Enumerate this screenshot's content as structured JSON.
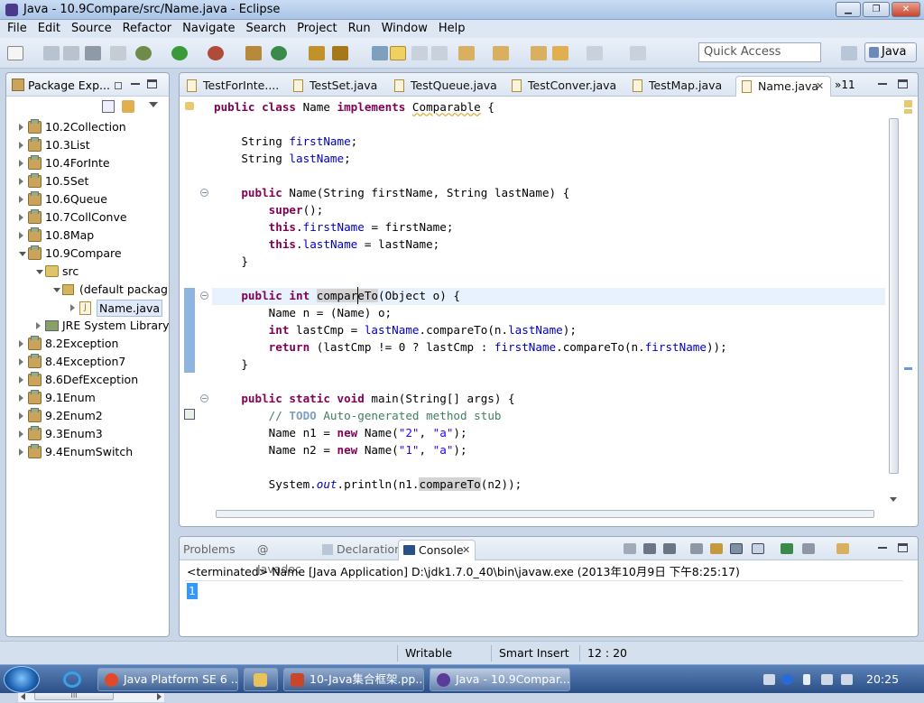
{
  "window": {
    "title": "Java - 10.9Compare/src/Name.java - Eclipse",
    "min": "▁",
    "max": "❐",
    "close": "✕"
  },
  "menu": [
    "File",
    "Edit",
    "Source",
    "Refactor",
    "Navigate",
    "Search",
    "Project",
    "Run",
    "Window",
    "Help"
  ],
  "toolbar": {
    "quick_access_placeholder": "Quick Access",
    "perspective": "Java"
  },
  "package_explorer": {
    "title": "Package Exp...",
    "tree": [
      {
        "label": "10.2Collection",
        "depth": 0,
        "kind": "project",
        "open": false
      },
      {
        "label": "10.3List",
        "depth": 0,
        "kind": "project",
        "open": false
      },
      {
        "label": "10.4ForInte",
        "depth": 0,
        "kind": "project",
        "open": false
      },
      {
        "label": "10.5Set",
        "depth": 0,
        "kind": "project",
        "open": false
      },
      {
        "label": "10.6Queue",
        "depth": 0,
        "kind": "project",
        "open": false
      },
      {
        "label": "10.7CollConve",
        "depth": 0,
        "kind": "project",
        "open": false
      },
      {
        "label": "10.8Map",
        "depth": 0,
        "kind": "project",
        "open": false
      },
      {
        "label": "10.9Compare",
        "depth": 0,
        "kind": "project",
        "open": true
      },
      {
        "label": "src",
        "depth": 1,
        "kind": "src",
        "open": true
      },
      {
        "label": "(default packag",
        "depth": 2,
        "kind": "package",
        "open": true
      },
      {
        "label": "Name.java",
        "depth": 3,
        "kind": "java",
        "open": false,
        "selected": true
      },
      {
        "label": "JRE System Library",
        "depth": 1,
        "kind": "lib",
        "open": false
      },
      {
        "label": "8.2Exception",
        "depth": 0,
        "kind": "project",
        "open": false
      },
      {
        "label": "8.4Exception7",
        "depth": 0,
        "kind": "project",
        "open": false
      },
      {
        "label": "8.6DefException",
        "depth": 0,
        "kind": "project",
        "open": false
      },
      {
        "label": "9.1Enum",
        "depth": 0,
        "kind": "project",
        "open": false
      },
      {
        "label": "9.2Enum2",
        "depth": 0,
        "kind": "project",
        "open": false
      },
      {
        "label": "9.3Enum3",
        "depth": 0,
        "kind": "project",
        "open": false
      },
      {
        "label": "9.4EnumSwitch",
        "depth": 0,
        "kind": "project",
        "open": false
      }
    ],
    "scroll_thumb": "III"
  },
  "editor": {
    "tabs": [
      {
        "label": "TestForInte....",
        "active": false
      },
      {
        "label": "TestSet.java",
        "active": false
      },
      {
        "label": "TestQueue.java",
        "active": false
      },
      {
        "label": "TestConver.java",
        "active": false
      },
      {
        "label": "TestMap.java",
        "active": false
      },
      {
        "label": "Name.java",
        "active": true
      }
    ],
    "overflow_label": "»11",
    "tab_close": "✕"
  },
  "console": {
    "tabs": [
      {
        "label": "Problems",
        "active": false
      },
      {
        "label": "@ Javadoc",
        "active": false
      },
      {
        "label": "Declaration",
        "active": false
      },
      {
        "label": "Console",
        "active": true
      }
    ],
    "description": "<terminated> Name [Java Application] D:\\jdk1.7.0_40\\bin\\javaw.exe (2013年10月9日 下午8:25:17)",
    "output": "1"
  },
  "status": {
    "writable": "Writable",
    "insert_mode": "Smart Insert",
    "position": "12 : 20"
  },
  "taskbar": {
    "apps": [
      {
        "label": "Java Platform SE 6 ...",
        "color": "#e04a2a",
        "active": false
      },
      {
        "label": "",
        "color": "#e8c25a",
        "active": false
      },
      {
        "label": "10-Java集合框架.pp...",
        "color": "#c8462a",
        "active": false
      },
      {
        "label": "Java - 10.9Compar...",
        "color": "#5a3d99",
        "active": true
      }
    ],
    "clock": "20:25"
  },
  "colors": {
    "keyword": "#7f0055",
    "field": "#0000c0",
    "string": "#2a00ff",
    "comment": "#3f7f5f"
  }
}
